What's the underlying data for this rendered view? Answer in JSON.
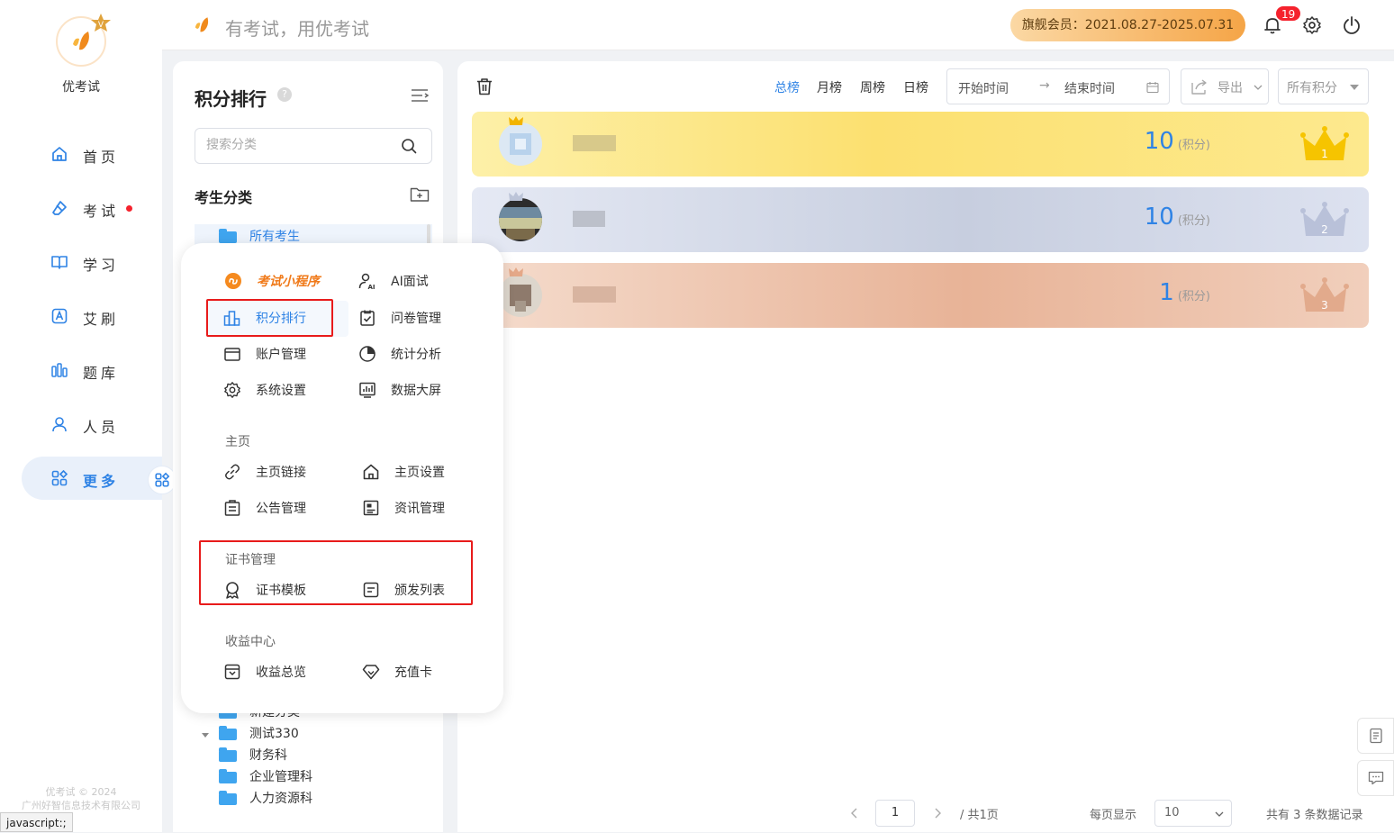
{
  "app": {
    "name": "优考试",
    "slogan": "有考试，用优考试"
  },
  "header": {
    "vip_label": "旗舰会员：2021.08.27-2025.07.31",
    "notification_count": "19"
  },
  "sidebar": {
    "items": [
      {
        "label": "首页",
        "icon": "home-icon"
      },
      {
        "label": "考试",
        "icon": "eraser-icon"
      },
      {
        "label": "学习",
        "icon": "book-icon"
      },
      {
        "label": "艾刷",
        "icon": "a-box-icon"
      },
      {
        "label": "题库",
        "icon": "bars-icon"
      },
      {
        "label": "人员",
        "icon": "user-icon"
      },
      {
        "label": "更多",
        "icon": "apps-icon"
      }
    ],
    "copyright_line1": "优考试 © 2024",
    "copyright_line2": "广州好智信息技术有限公司"
  },
  "status_bar": {
    "text": "javascript:;"
  },
  "category_panel": {
    "title": "积分排行",
    "help": "?",
    "search_placeholder": "搜索分类",
    "section_title": "考生分类",
    "tree": [
      {
        "label": "所有考生"
      },
      {
        "label": "新建分类"
      },
      {
        "label": "测试330"
      },
      {
        "label": "财务科"
      },
      {
        "label": "企业管理科"
      },
      {
        "label": "人力资源科"
      }
    ]
  },
  "main": {
    "tabs": [
      "总榜",
      "月榜",
      "周榜",
      "日榜"
    ],
    "active_tab": "总榜",
    "date_start_placeholder": "开始时间",
    "date_arrow": "→",
    "date_end_placeholder": "结束时间",
    "export_label": "导出",
    "score_filter": "所有积分",
    "rankings": [
      {
        "rank": "1",
        "score": "10",
        "unit": "(积分)",
        "color": "#fcd23a"
      },
      {
        "rank": "2",
        "score": "10",
        "unit": "(积分)",
        "color": "#c9d0e4"
      },
      {
        "rank": "3",
        "score": "1",
        "unit": "(积分)",
        "color": "#ecbfa5"
      }
    ],
    "pagination": {
      "current_page": "1",
      "total_pages": "/ 共1页",
      "per_page_label": "每页显示",
      "per_page": "10",
      "total_records": "共有 3 条数据记录"
    }
  },
  "popup": {
    "featured": "考试小程序",
    "items_main": [
      {
        "label": "AI面试",
        "icon": "ai-user-icon"
      },
      {
        "label": "积分排行",
        "icon": "ranking-icon"
      },
      {
        "label": "问卷管理",
        "icon": "clipboard-check-icon"
      },
      {
        "label": "账户管理",
        "icon": "wallet-icon"
      },
      {
        "label": "统计分析",
        "icon": "pie-chart-icon"
      },
      {
        "label": "系统设置",
        "icon": "gear-icon"
      },
      {
        "label": "数据大屏",
        "icon": "dashboard-icon"
      }
    ],
    "section_home": "主页",
    "items_home": [
      {
        "label": "主页链接",
        "icon": "link-icon"
      },
      {
        "label": "主页设置",
        "icon": "home-icon"
      },
      {
        "label": "公告管理",
        "icon": "notice-icon"
      },
      {
        "label": "资讯管理",
        "icon": "news-icon"
      }
    ],
    "section_cert": "证书管理",
    "items_cert": [
      {
        "label": "证书模板",
        "icon": "medal-icon"
      },
      {
        "label": "颁发列表",
        "icon": "list-doc-icon"
      }
    ],
    "section_income": "收益中心",
    "items_income": [
      {
        "label": "收益总览",
        "icon": "income-icon"
      },
      {
        "label": "充值卡",
        "icon": "diamond-icon"
      }
    ]
  }
}
